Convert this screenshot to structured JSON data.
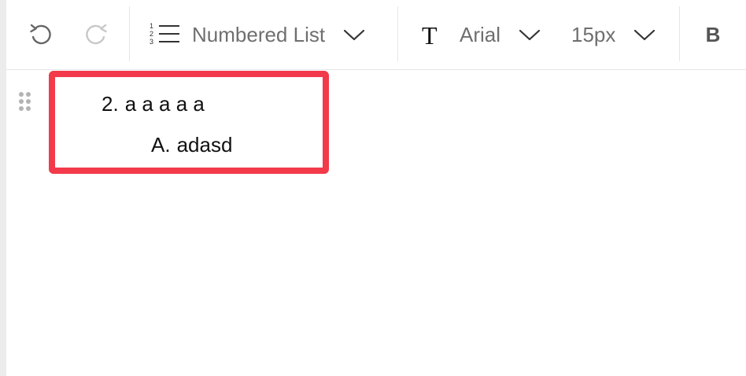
{
  "toolbar": {
    "undo_icon": "undo-icon",
    "redo_icon": "redo-icon",
    "list_type": {
      "icon": "numbered-list-icon",
      "label": "Numbered List"
    },
    "font_family": {
      "icon": "text-type-icon",
      "label": "Arial"
    },
    "font_size": {
      "label": "15px"
    },
    "bold_label": "B"
  },
  "editor": {
    "list_items": [
      {
        "marker": "2.",
        "text": "a a a a a",
        "level": 1
      },
      {
        "marker": "A.",
        "text": "adasd",
        "level": 2
      }
    ]
  },
  "colors": {
    "highlight_border": "#f23a4a",
    "toolbar_text": "#6f6f6f",
    "redo_disabled": "#c8c8c8"
  }
}
